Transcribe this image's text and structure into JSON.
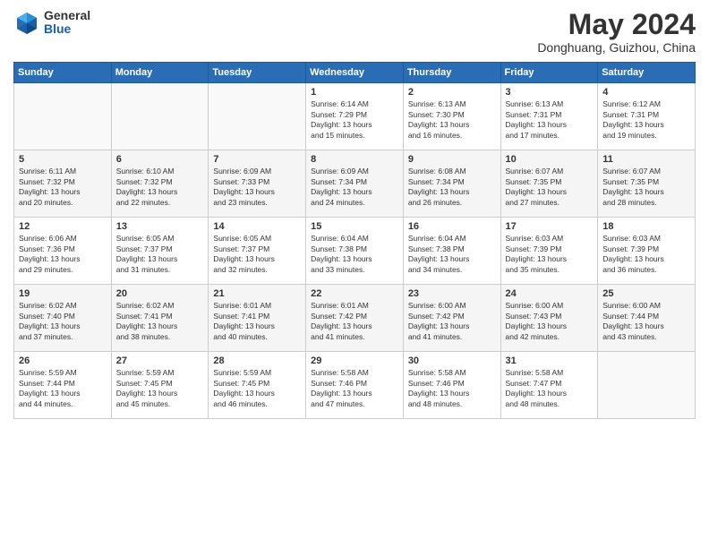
{
  "header": {
    "logo_general": "General",
    "logo_blue": "Blue",
    "month_year": "May 2024",
    "location": "Donghuang, Guizhou, China"
  },
  "days_of_week": [
    "Sunday",
    "Monday",
    "Tuesday",
    "Wednesday",
    "Thursday",
    "Friday",
    "Saturday"
  ],
  "weeks": [
    [
      {
        "day": "",
        "info": ""
      },
      {
        "day": "",
        "info": ""
      },
      {
        "day": "",
        "info": ""
      },
      {
        "day": "1",
        "info": "Sunrise: 6:14 AM\nSunset: 7:29 PM\nDaylight: 13 hours\nand 15 minutes."
      },
      {
        "day": "2",
        "info": "Sunrise: 6:13 AM\nSunset: 7:30 PM\nDaylight: 13 hours\nand 16 minutes."
      },
      {
        "day": "3",
        "info": "Sunrise: 6:13 AM\nSunset: 7:31 PM\nDaylight: 13 hours\nand 17 minutes."
      },
      {
        "day": "4",
        "info": "Sunrise: 6:12 AM\nSunset: 7:31 PM\nDaylight: 13 hours\nand 19 minutes."
      }
    ],
    [
      {
        "day": "5",
        "info": "Sunrise: 6:11 AM\nSunset: 7:32 PM\nDaylight: 13 hours\nand 20 minutes."
      },
      {
        "day": "6",
        "info": "Sunrise: 6:10 AM\nSunset: 7:32 PM\nDaylight: 13 hours\nand 22 minutes."
      },
      {
        "day": "7",
        "info": "Sunrise: 6:09 AM\nSunset: 7:33 PM\nDaylight: 13 hours\nand 23 minutes."
      },
      {
        "day": "8",
        "info": "Sunrise: 6:09 AM\nSunset: 7:34 PM\nDaylight: 13 hours\nand 24 minutes."
      },
      {
        "day": "9",
        "info": "Sunrise: 6:08 AM\nSunset: 7:34 PM\nDaylight: 13 hours\nand 26 minutes."
      },
      {
        "day": "10",
        "info": "Sunrise: 6:07 AM\nSunset: 7:35 PM\nDaylight: 13 hours\nand 27 minutes."
      },
      {
        "day": "11",
        "info": "Sunrise: 6:07 AM\nSunset: 7:35 PM\nDaylight: 13 hours\nand 28 minutes."
      }
    ],
    [
      {
        "day": "12",
        "info": "Sunrise: 6:06 AM\nSunset: 7:36 PM\nDaylight: 13 hours\nand 29 minutes."
      },
      {
        "day": "13",
        "info": "Sunrise: 6:05 AM\nSunset: 7:37 PM\nDaylight: 13 hours\nand 31 minutes."
      },
      {
        "day": "14",
        "info": "Sunrise: 6:05 AM\nSunset: 7:37 PM\nDaylight: 13 hours\nand 32 minutes."
      },
      {
        "day": "15",
        "info": "Sunrise: 6:04 AM\nSunset: 7:38 PM\nDaylight: 13 hours\nand 33 minutes."
      },
      {
        "day": "16",
        "info": "Sunrise: 6:04 AM\nSunset: 7:38 PM\nDaylight: 13 hours\nand 34 minutes."
      },
      {
        "day": "17",
        "info": "Sunrise: 6:03 AM\nSunset: 7:39 PM\nDaylight: 13 hours\nand 35 minutes."
      },
      {
        "day": "18",
        "info": "Sunrise: 6:03 AM\nSunset: 7:39 PM\nDaylight: 13 hours\nand 36 minutes."
      }
    ],
    [
      {
        "day": "19",
        "info": "Sunrise: 6:02 AM\nSunset: 7:40 PM\nDaylight: 13 hours\nand 37 minutes."
      },
      {
        "day": "20",
        "info": "Sunrise: 6:02 AM\nSunset: 7:41 PM\nDaylight: 13 hours\nand 38 minutes."
      },
      {
        "day": "21",
        "info": "Sunrise: 6:01 AM\nSunset: 7:41 PM\nDaylight: 13 hours\nand 40 minutes."
      },
      {
        "day": "22",
        "info": "Sunrise: 6:01 AM\nSunset: 7:42 PM\nDaylight: 13 hours\nand 41 minutes."
      },
      {
        "day": "23",
        "info": "Sunrise: 6:00 AM\nSunset: 7:42 PM\nDaylight: 13 hours\nand 41 minutes."
      },
      {
        "day": "24",
        "info": "Sunrise: 6:00 AM\nSunset: 7:43 PM\nDaylight: 13 hours\nand 42 minutes."
      },
      {
        "day": "25",
        "info": "Sunrise: 6:00 AM\nSunset: 7:44 PM\nDaylight: 13 hours\nand 43 minutes."
      }
    ],
    [
      {
        "day": "26",
        "info": "Sunrise: 5:59 AM\nSunset: 7:44 PM\nDaylight: 13 hours\nand 44 minutes."
      },
      {
        "day": "27",
        "info": "Sunrise: 5:59 AM\nSunset: 7:45 PM\nDaylight: 13 hours\nand 45 minutes."
      },
      {
        "day": "28",
        "info": "Sunrise: 5:59 AM\nSunset: 7:45 PM\nDaylight: 13 hours\nand 46 minutes."
      },
      {
        "day": "29",
        "info": "Sunrise: 5:58 AM\nSunset: 7:46 PM\nDaylight: 13 hours\nand 47 minutes."
      },
      {
        "day": "30",
        "info": "Sunrise: 5:58 AM\nSunset: 7:46 PM\nDaylight: 13 hours\nand 48 minutes."
      },
      {
        "day": "31",
        "info": "Sunrise: 5:58 AM\nSunset: 7:47 PM\nDaylight: 13 hours\nand 48 minutes."
      },
      {
        "day": "",
        "info": ""
      }
    ]
  ]
}
